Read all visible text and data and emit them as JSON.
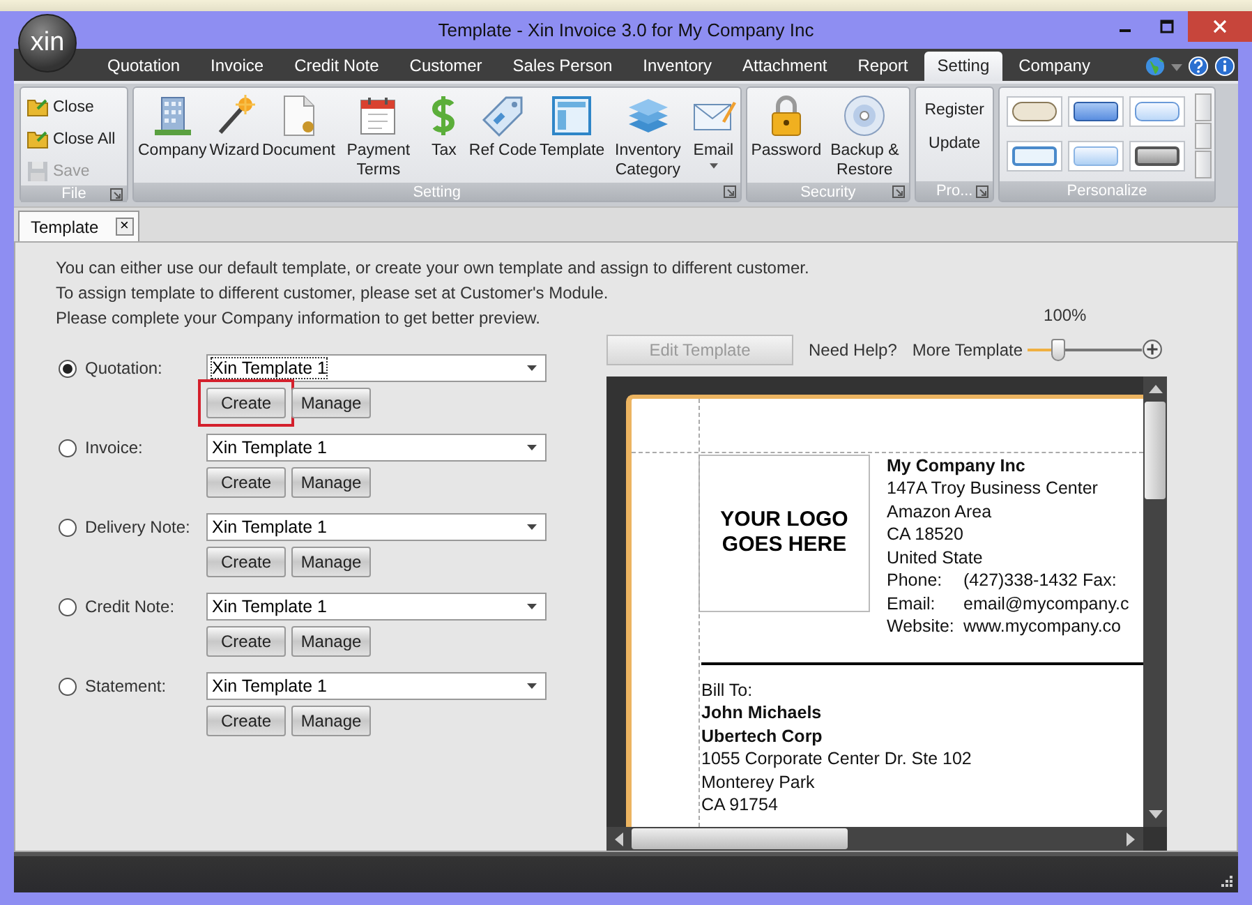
{
  "window": {
    "title": "Template - Xin Invoice 3.0 for My Company Inc",
    "logo": "xin"
  },
  "menu_tabs": [
    {
      "label": "Quotation",
      "selected": false
    },
    {
      "label": "Invoice",
      "selected": false
    },
    {
      "label": "Credit Note",
      "selected": false
    },
    {
      "label": "Customer",
      "selected": false
    },
    {
      "label": "Sales Person",
      "selected": false
    },
    {
      "label": "Inventory",
      "selected": false
    },
    {
      "label": "Attachment",
      "selected": false
    },
    {
      "label": "Report",
      "selected": false
    },
    {
      "label": "Setting",
      "selected": true
    },
    {
      "label": "Company",
      "selected": false
    }
  ],
  "ribbon": {
    "groups": [
      {
        "title": "File",
        "kind": "small",
        "launcher": true,
        "items": [
          {
            "label": "Close",
            "disabled": false
          },
          {
            "label": "Close All",
            "disabled": false
          },
          {
            "label": "Save",
            "disabled": true
          }
        ]
      },
      {
        "title": "Setting",
        "kind": "large",
        "launcher": true,
        "items": [
          {
            "label": "Company",
            "dropdown": false
          },
          {
            "label": "Wizard",
            "dropdown": false
          },
          {
            "label": "Document",
            "dropdown": false
          },
          {
            "label": "Payment Terms",
            "dropdown": false
          },
          {
            "label": "Tax",
            "dropdown": false
          },
          {
            "label": "Ref Code",
            "dropdown": false
          },
          {
            "label": "Template",
            "dropdown": false
          },
          {
            "label": "Inventory Category",
            "dropdown": false
          },
          {
            "label": "Email",
            "dropdown": true
          }
        ]
      },
      {
        "title": "Security",
        "kind": "large",
        "launcher": true,
        "items": [
          {
            "label": "Password",
            "dropdown": false
          },
          {
            "label": "Backup & Restore",
            "dropdown": false
          }
        ]
      },
      {
        "title": "Pro...",
        "kind": "text",
        "launcher": true,
        "items": [
          {
            "label": "Register"
          },
          {
            "label": "Update"
          }
        ]
      },
      {
        "title": "Personalize",
        "kind": "swatches",
        "launcher": false
      }
    ]
  },
  "document_tabs": [
    {
      "label": "Template",
      "selected": true,
      "close": "×"
    }
  ],
  "instructions": [
    "You can either use our default template, or create your own template and assign to different customer.",
    "To assign template to different customer, please set at Customer's Module.",
    "Please complete your Company information to get better preview."
  ],
  "template_rows": [
    {
      "label": "Quotation:",
      "selected": true,
      "template": "Xin Template 1",
      "buttons": [
        {
          "label": "Create",
          "highlighted": true
        },
        {
          "label": "Manage",
          "highlighted": false
        }
      ]
    },
    {
      "label": "Invoice:",
      "selected": false,
      "template": "Xin Template 1",
      "buttons": [
        {
          "label": "Create",
          "highlighted": false
        },
        {
          "label": "Manage",
          "highlighted": false
        }
      ]
    },
    {
      "label": "Delivery Note:",
      "selected": false,
      "template": "Xin Template 1",
      "buttons": [
        {
          "label": "Create",
          "highlighted": false
        },
        {
          "label": "Manage",
          "highlighted": false
        }
      ]
    },
    {
      "label": "Credit Note:",
      "selected": false,
      "template": "Xin Template 1",
      "buttons": [
        {
          "label": "Create",
          "highlighted": false
        },
        {
          "label": "Manage",
          "highlighted": false
        }
      ]
    },
    {
      "label": "Statement:",
      "selected": false,
      "template": "Xin Template 1",
      "buttons": [
        {
          "label": "Create",
          "highlighted": false
        },
        {
          "label": "Manage",
          "highlighted": false
        }
      ]
    }
  ],
  "preview_toolbar": {
    "edit_button": {
      "label": "Edit Template",
      "disabled": true
    },
    "help_link": "Need Help?",
    "more_link": "More Template",
    "zoom": {
      "reading": "100%",
      "level": 0.28
    }
  },
  "preview": {
    "logo_placeholder": "YOUR LOGO GOES HERE",
    "company_name": "My Company Inc",
    "company_lines": [
      "147A Troy Business Center",
      "Amazon Area",
      "CA 18520",
      "United State"
    ],
    "contacts": [
      {
        "label": "Phone:",
        "value": "(427)338-1432  Fax:"
      },
      {
        "label": "Email:",
        "value": "email@mycompany.c"
      },
      {
        "label": "Website:",
        "value": "www.mycompany.co"
      }
    ],
    "bill_to_label": "Bill To:",
    "customer_name": "John Michaels",
    "customer_company": "Ubertech Corp",
    "customer_lines": [
      "1055 Corporate Center Dr. Ste 102",
      "Monterey Park",
      "CA 91754"
    ]
  }
}
